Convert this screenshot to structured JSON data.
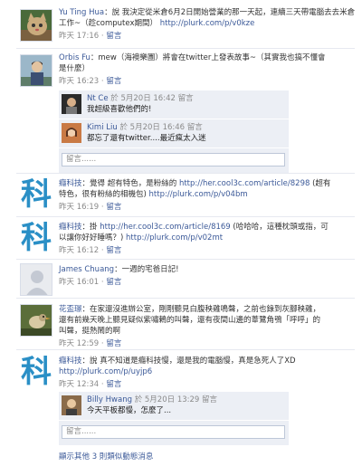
{
  "stories": [
    {
      "author": "Yu Ting Hua",
      "text": "：說 我決定從米倉6月2日開始營業的那一天起，連續三天帶電腦去去米倉",
      "text2": "工作~（趁computex期間）",
      "link": "http://plurk.com/p/v0kze",
      "time": "昨天 17:16",
      "action": "留言"
    },
    {
      "author": "Orbis Fu",
      "text": "：mew（海襖樂團）將會在twitter上發表故事~（其實我也搞不懂會",
      "text2": "是什麼）",
      "time": "昨天 16:23",
      "action": "留言",
      "comments": [
        {
          "author": "Nt Ce",
          "meta": "於 5月20日 16:42 留言",
          "body": "我超級喜歡他們的!"
        },
        {
          "author": "Kimi Liu",
          "meta": "於 5月20日 16:46 留言",
          "body": "都忘了還有twitter....最近瘋太入迷"
        }
      ],
      "comment_placeholder": "留言......"
    },
    {
      "author": "癮科技",
      "text": "：覺得 超有特色，是粉絲的",
      "link_inline": "http://her.cool3c.com/article/8298",
      "text_after": "(超有",
      "text2": "特色，很有粉絲的相機包)",
      "link": "http://plurk.com/p/v04bm",
      "time": "昨天 16:19",
      "action": "留言"
    },
    {
      "author": "癮科技",
      "text": "：掛",
      "link_inline": "http://her.cool3c.com/article/8169",
      "text_after": "(哈哈哈，這種枕頭或指，可",
      "text2": "以讓你好好睡嗎？)",
      "link": "http://plurk.com/p/v02mt",
      "time": "昨天 16:12",
      "action": "留言"
    },
    {
      "author": "James Chuang",
      "text": "：一週的宅爸日記!",
      "time": "昨天 16:01",
      "action": "留言"
    },
    {
      "author": "花盃璟",
      "text": "：在家還沒進辦公室，剛剛聽見白腹秧雞鳴聲，之前也錄到灰腳秧雞，",
      "text2": "還有前幾天晚上聽見疑似紫嘯鶇的叫聲，還有夜間山邊的葦鷺角鴞「呼呼」的",
      "text3": "叫聲，挺熱鬧的啊",
      "time": "昨天 12:59",
      "action": "留言"
    },
    {
      "author": "癮科技",
      "text": "：說 真不知道是癮科技慢，還是我的電腦慢，真是急死人了XD",
      "link": "http://plurk.com/p/uyjp6",
      "time": "昨天 12:34",
      "action": "留言",
      "comments": [
        {
          "author": "Billy Hwang",
          "meta": "於 5月20日 13:29 留言",
          "body": "今天平板都慢，怎麼了..."
        }
      ],
      "comment_placeholder": "留言......"
    }
  ],
  "separator": "·",
  "footer": "顯示其他 3 則類似動態消息",
  "icon_char": "科",
  "colors": {
    "link": "#3b5998",
    "meta": "#8a8a8a",
    "comment_bg": "#eceff5",
    "ke": "#2a8fc6"
  }
}
